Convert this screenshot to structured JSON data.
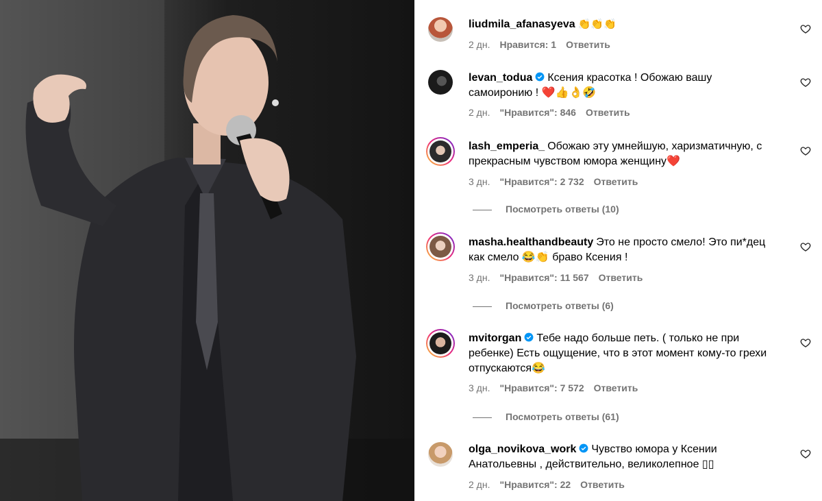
{
  "post": {
    "image_alt": "performer-with-microphone"
  },
  "comments": [
    {
      "username": "liudmila_afanasyeva",
      "verified": false,
      "text": "👏👏👏",
      "time": "2 дн.",
      "likes": "Нравится: 1",
      "reply": "Ответить"
    },
    {
      "username": "levan_todua",
      "verified": true,
      "text": "Ксения красотка ! Обожаю вашу самоиронию ! ❤️👍👌🤣",
      "time": "2 дн.",
      "likes": "\"Нравится\": 846",
      "reply": "Ответить"
    },
    {
      "username": "lash_emperia_",
      "verified": false,
      "text": "Обожаю эту умнейшую, харизматичную, с прекрасным чувством юмора женщину❤️",
      "time": "3 дн.",
      "likes": "\"Нравится\": 2 732",
      "reply": "Ответить",
      "view_replies": "Посмотреть ответы (10)"
    },
    {
      "username": "masha.healthandbeauty",
      "verified": false,
      "text": "Это не просто смело! Это пи*дец как смело 😂👏 браво Ксения !",
      "time": "3 дн.",
      "likes": "\"Нравится\": 11 567",
      "reply": "Ответить",
      "view_replies": "Посмотреть ответы (6)"
    },
    {
      "username": "mvitorgan",
      "verified": true,
      "text": "Тебе надо больше петь. ( только не при ребенке) Есть ощущение, что в этот момент кому-то грехи отпускаются😂",
      "time": "3 дн.",
      "likes": "\"Нравится\": 7 572",
      "reply": "Ответить",
      "view_replies": "Посмотреть ответы (61)"
    },
    {
      "username": "olga_novikova_work",
      "verified": true,
      "text": "Чувство юмора у Ксении Анатольевны , действительно, великолепное ▯▯",
      "time": "2 дн.",
      "likes": "\"Нравится\": 22",
      "reply": "Ответить"
    }
  ],
  "colors": {
    "verified": "#0095f6",
    "meta": "#737373",
    "heart": "#262626"
  },
  "icons": {
    "like": "heart-outline-icon",
    "verified": "verified-badge-icon"
  }
}
